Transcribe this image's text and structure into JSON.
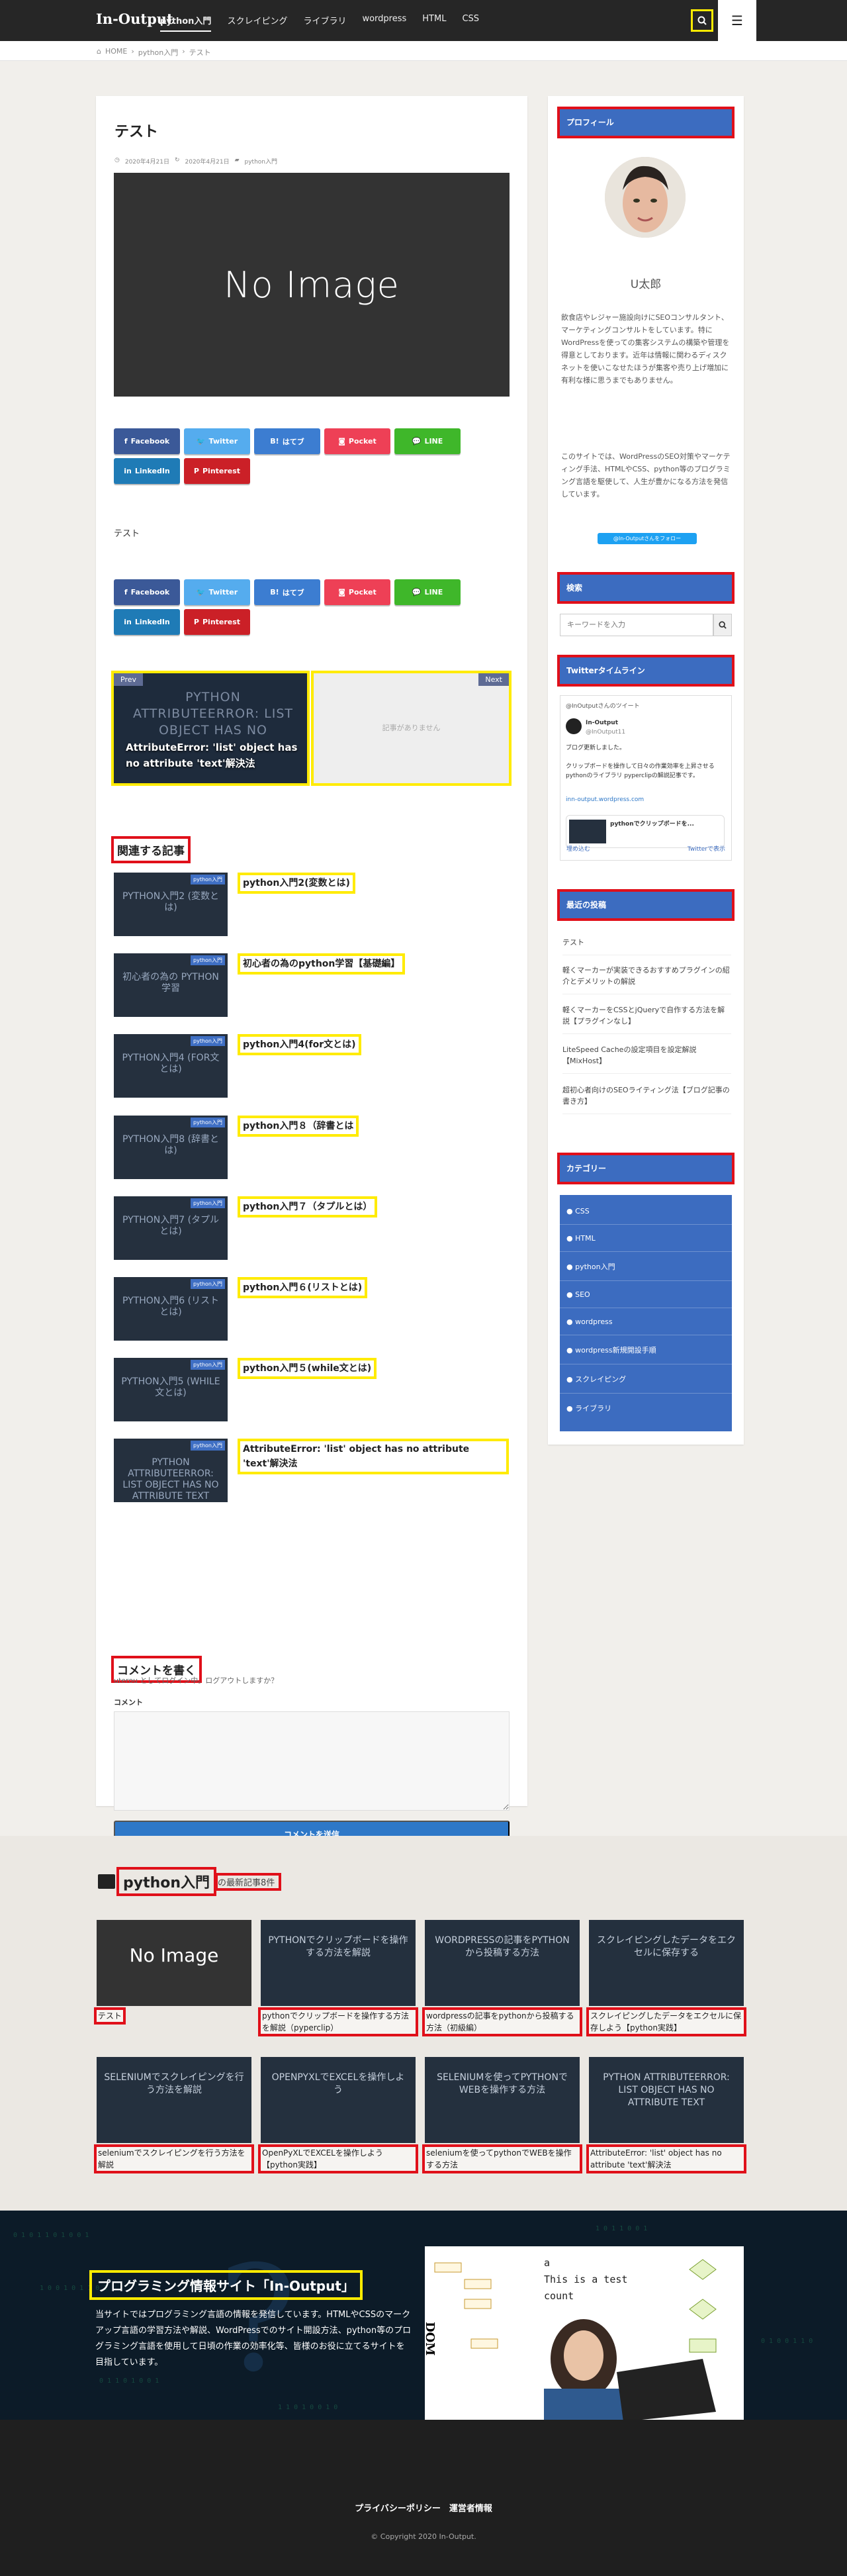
{
  "header": {
    "logo": "In-Output",
    "nav": [
      "python入門",
      "スクレイピング",
      "ライブラリ",
      "wordpress",
      "HTML",
      "CSS"
    ]
  },
  "breadcrumb": [
    "HOME",
    "python入門",
    "テスト"
  ],
  "post": {
    "title": "テスト",
    "date_published": "2020年4月21日",
    "date_updated": "2020年4月21日",
    "category": "python入門",
    "eyecatch_text": "No Image",
    "body": "テスト"
  },
  "share": [
    "Facebook",
    "Twitter",
    "はてブ",
    "Pocket",
    "LINE",
    "LinkedIn",
    "Pinterest"
  ],
  "pager": {
    "prev_label": "Prev",
    "prev_bg": "PYTHON ATTRIBUTEERROR: LIST OBJECT HAS NO",
    "prev_title": "AttributeError: 'list' object has no attribute 'text'解決法",
    "next_label": "Next",
    "next_empty": "記事がありません"
  },
  "related": {
    "heading": "関連する記事",
    "cat": "python入門",
    "items": [
      {
        "thumb": "PYTHON入門2 (変数とは)",
        "title": "python入門2(変数とは)"
      },
      {
        "thumb": "初心者の為の PYTHON学習",
        "title": "初心者の為のpython学習【基礎編】"
      },
      {
        "thumb": "PYTHON入門4 (FOR文とは)",
        "title": "python入門4(for文とは)"
      },
      {
        "thumb": "PYTHON入門8 (辞書とは)",
        "title": "python入門８（辞書とは"
      },
      {
        "thumb": "PYTHON入門7 (タプルとは)",
        "title": "python入門７（タプルとは）"
      },
      {
        "thumb": "PYTHON入門6 (リストとは)",
        "title": "python入門６(リストとは)"
      },
      {
        "thumb": "PYTHON入門5 (WHILE文とは)",
        "title": "python入門５(while文とは)"
      },
      {
        "thumb": "PYTHON ATTRIBUTEERROR: LIST OBJECT HAS NO ATTRIBUTE TEXT",
        "title": "AttributeError: 'list' object has no attribute 'text'解決法"
      }
    ]
  },
  "comment": {
    "heading": "コメントを書く",
    "login": "uterou としてログイン中。ログアウトしますか？",
    "label": "コメント",
    "submit": "コメントを送信"
  },
  "sidebar": {
    "profile_h": "プロフィール",
    "name": "U太郎",
    "bio1": "飲食店やレジャー施設向けにSEOコンサルタント、マーケティングコンサルトをしています。特にWordPressを使っての集客システムの構築や管理を得意としております。近年は情報に関わるディスクネットを使いこなせたほうが集客や売り上げ増加に有利な様に思うまでもありません。",
    "bio2": "このサイトでは、WordPressのSEO対策やマーケティング手法、HTMLやCSS、python等のプログラミング言語を駆使して、人生が豊かになる方法を発信しています。",
    "follow": "@In-Outputさんをフォロー",
    "search_h": "検索",
    "search_ph": "キーワードを入力",
    "twitter_h": "Twitterタイムライン",
    "tw_title": "@InOutputさんのツイート",
    "tw_user": "In-Output",
    "tw_handle": "@InOutput11",
    "tw_text1": "ブログ更新しました。",
    "tw_text2": "クリップボードを操作して日々の作業効率を上昇させるpythonのライブラリ pyperclipの解説記事です。",
    "tw_embed": "pythonでクリップボードを...",
    "tw_embed_link": "inn-output.wordpress.com",
    "tw_footer_l": "埋め込む",
    "tw_footer_r": "Twitterで表示",
    "recent_h": "最近の投稿",
    "recent": [
      "テスト",
      "軽くマーカーが実装できるおすすめプラグインの紹介とデメリットの解説",
      "軽くマーカーをCSSとjQueryで自作する方法を解説【プラグインなし】",
      "LiteSpeed Cacheの設定項目を設定解説【MixHost】",
      "超初心者向けのSEOライティング法【ブログ記事の書き方】"
    ],
    "cat_h": "カテゴリー",
    "cats": [
      "CSS",
      "HTML",
      "python入門",
      "SEO",
      "wordpress",
      "wordpress新規開設手順",
      "スクレイピング",
      "ライブラリ"
    ]
  },
  "latest": {
    "title": "python入門",
    "sub": "の最新記事8件",
    "cards": [
      {
        "img": "No Image",
        "title": "テスト"
      },
      {
        "img": "PYTHONでクリップボードを操作する方法を解説",
        "title": "pythonでクリップボードを操作する方法を解説（pyperclip）"
      },
      {
        "img": "WORDPRESSの記事をPYTHONから投稿する方法",
        "title": "wordpressの記事をpythonから投稿する方法（初級編）"
      },
      {
        "img": "スクレイピングしたデータをエクセルに保存する",
        "title": "スクレイピングしたデータをエクセルに保存しよう【python実践】"
      },
      {
        "img": "SELENIUMでスクレイピングを行う方法を解説",
        "title": "seleniumでスクレイピングを行う方法を解説"
      },
      {
        "img": "OPENPYXLでEXCELを操作しよう",
        "title": "OpenPyXLでEXCELを操作しよう【python実践】"
      },
      {
        "img": "SELENIUMを使ってPYTHONでWEBを操作する方法",
        "title": "seleniumを使ってpythonでWEBを操作する方法"
      },
      {
        "img": "PYTHON ATTRIBUTEERROR: LIST OBJECT HAS NO ATTRIBUTE TEXT",
        "title": "AttributeError: 'list' object has no attribute 'text'解決法"
      }
    ]
  },
  "hero": {
    "title": "プログラミング情報サイト「In-Output」",
    "desc": "当サイトではプログラミング言語の情報を発信しています。HTMLやCSSのマークアップ言語の学習方法や解説、WordPressでのサイト開設方法、python等のプログラミング言語を使用して日頃の作業の効率化等、皆様のお役に立てるサイトを目指しています。",
    "code": "a This is a test count"
  },
  "footer": {
    "links": "プライバシーポリシー　運営者情報",
    "copyright": "© Copyright 2020 In-Output."
  }
}
